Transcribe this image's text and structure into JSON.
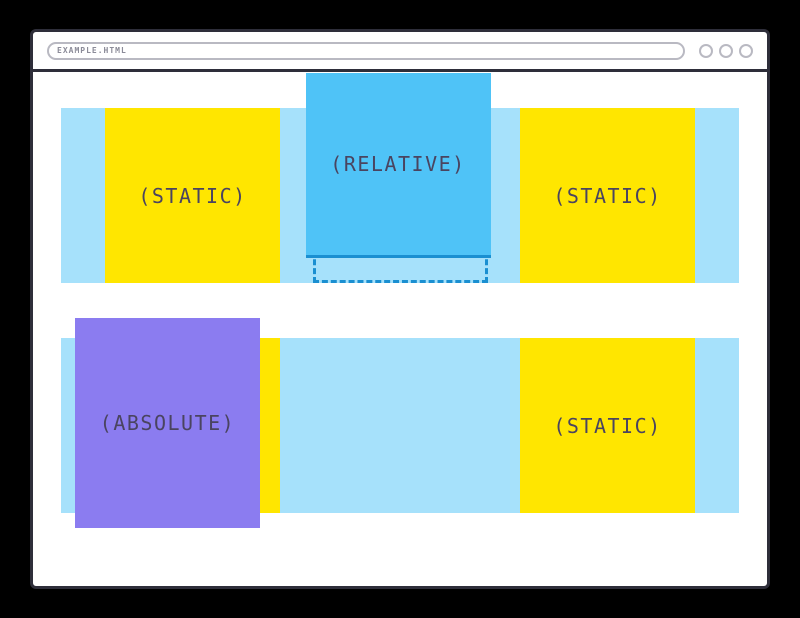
{
  "address_bar": "EXAMPLE.HTML",
  "rows": {
    "top": {
      "left": "(STATIC)",
      "mid": "(RELATIVE)",
      "right": "(STATIC)"
    },
    "bottom": {
      "absolute": "(ABSOLUTE)",
      "right": "(STATIC)"
    }
  }
}
